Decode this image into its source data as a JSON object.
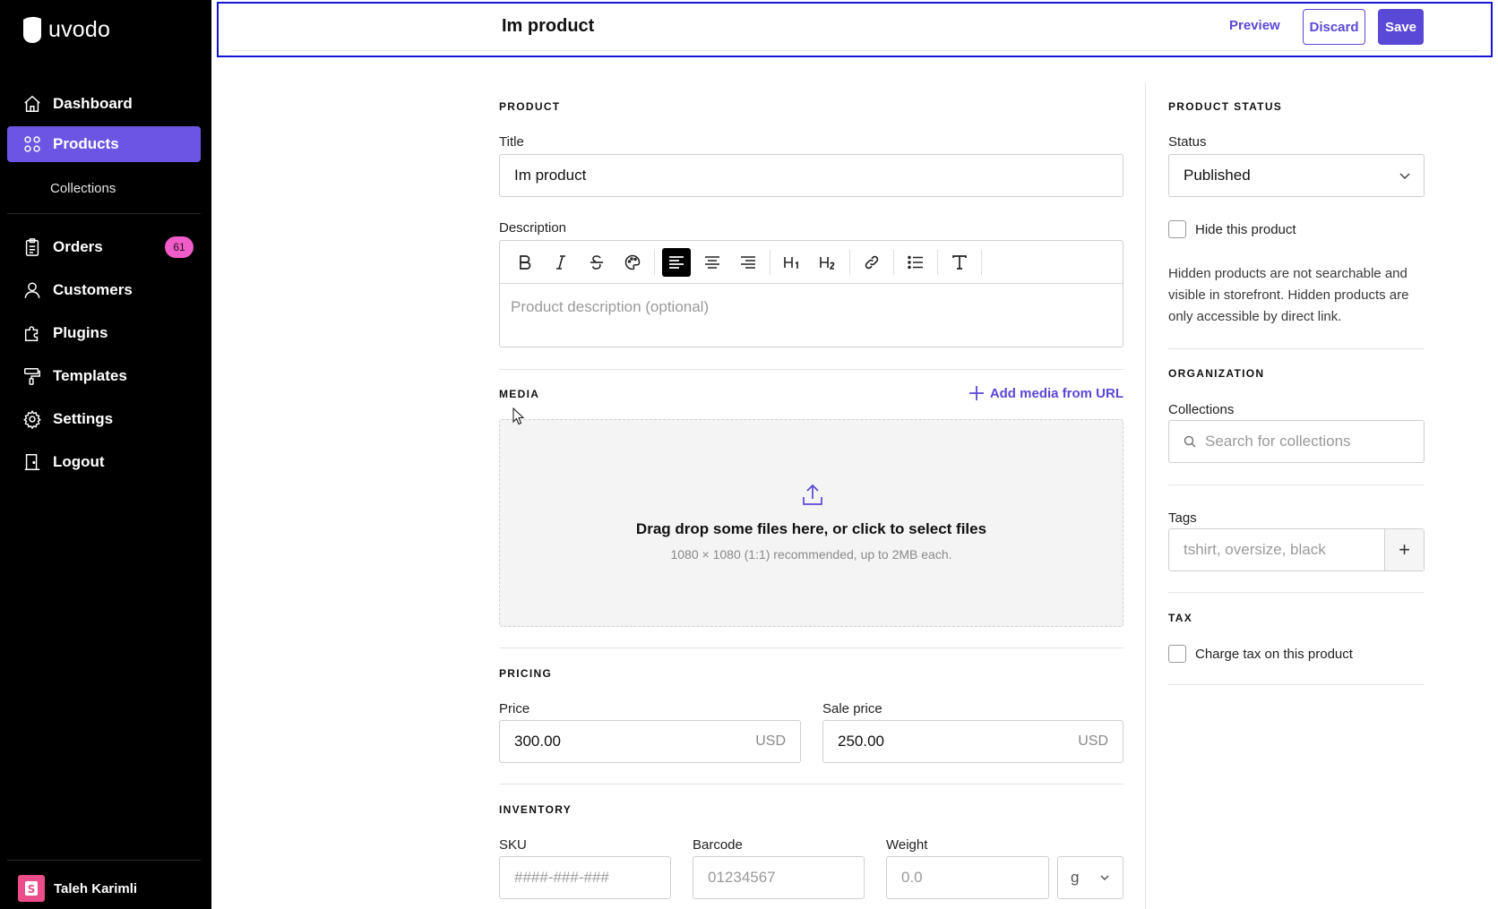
{
  "brand": {
    "name": "uvodo"
  },
  "sidebar": {
    "items": [
      {
        "label": "Dashboard",
        "icon": "home-icon"
      },
      {
        "label": "Products",
        "icon": "grid-icon",
        "active": true
      },
      {
        "label": "Orders",
        "icon": "clipboard-icon",
        "badge": "61"
      },
      {
        "label": "Customers",
        "icon": "user-icon"
      },
      {
        "label": "Plugins",
        "icon": "puzzle-icon"
      },
      {
        "label": "Templates",
        "icon": "paint-roller-icon"
      },
      {
        "label": "Settings",
        "icon": "gear-icon"
      },
      {
        "label": "Logout",
        "icon": "door-icon"
      }
    ],
    "sub_items": [
      {
        "label": "Collections"
      }
    ],
    "user": {
      "name": "Taleh Karimli"
    },
    "accent": "#6d55e4",
    "badge_color": "#f05cc8"
  },
  "header": {
    "title": "Im product",
    "preview_label": "Preview",
    "discard_label": "Discard",
    "save_label": "Save",
    "accent": "#5a48d6"
  },
  "product": {
    "section_title": "PRODUCT",
    "title_label": "Title",
    "title_value": "Im product",
    "description_label": "Description",
    "description_placeholder": "Product description (optional)",
    "toolbar": [
      "bold-icon",
      "italic-icon",
      "strikethrough-icon",
      "palette-icon",
      "align-left-icon",
      "align-center-icon",
      "align-right-icon",
      "heading-1-icon",
      "heading-2-icon",
      "link-icon",
      "bullet-list-icon",
      "text-format-icon"
    ]
  },
  "media": {
    "section_title": "MEDIA",
    "add_url_label": "Add media from URL",
    "drop_title": "Drag drop some files here, or click to select files",
    "drop_hint": "1080 × 1080 (1:1) recommended, up to 2MB each."
  },
  "pricing": {
    "section_title": "PRICING",
    "price_label": "Price",
    "price_value": "300.00",
    "price_currency": "USD",
    "sale_label": "Sale price",
    "sale_value": "250.00",
    "sale_currency": "USD"
  },
  "inventory": {
    "section_title": "INVENTORY",
    "sku_label": "SKU",
    "sku_placeholder": "####-###-###",
    "barcode_label": "Barcode",
    "barcode_placeholder": "01234567",
    "weight_label": "Weight",
    "weight_placeholder": "0.0",
    "weight_unit": "g"
  },
  "status": {
    "section_title": "PRODUCT STATUS",
    "status_label": "Status",
    "status_value": "Published",
    "hide_label": "Hide this product",
    "help_text": "Hidden products are not searchable and visible in storefront. Hidden products are only accessible by direct link."
  },
  "organization": {
    "section_title": "ORGANIZATION",
    "collections_label": "Collections",
    "collections_placeholder": "Search for collections",
    "tags_label": "Tags",
    "tags_placeholder": "tshirt, oversize, black",
    "tags_add": "+"
  },
  "tax": {
    "section_title": "TAX",
    "charge_label": "Charge tax on this product"
  }
}
